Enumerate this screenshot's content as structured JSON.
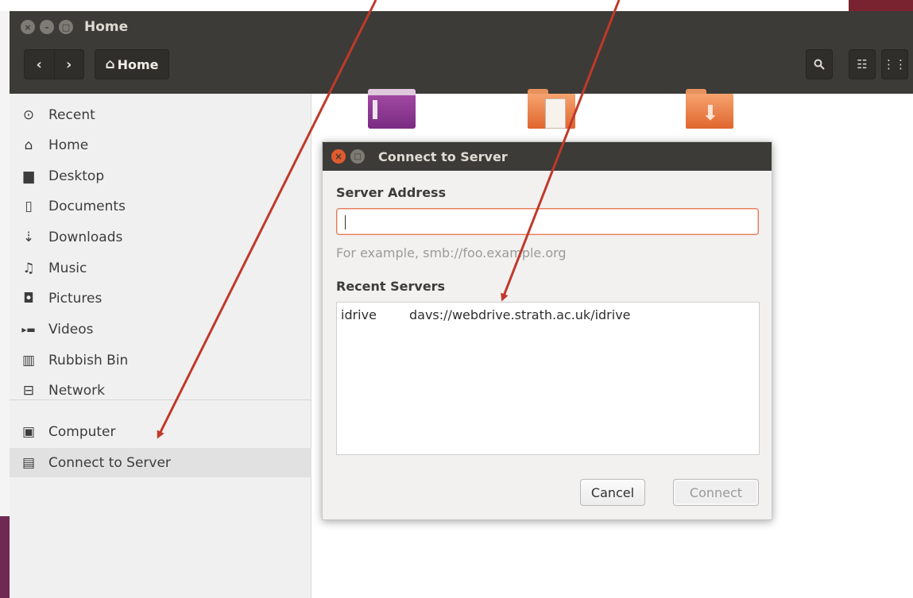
{
  "window": {
    "title": "Home",
    "path_label": "Home"
  },
  "sidebar": {
    "items": [
      {
        "label": "Recent",
        "icon": "recent-icon",
        "glyph": "⊙"
      },
      {
        "label": "Home",
        "icon": "home-icon",
        "glyph": "⌂"
      },
      {
        "label": "Desktop",
        "icon": "folder-icon",
        "glyph": "▆"
      },
      {
        "label": "Documents",
        "icon": "document-icon",
        "glyph": "▯"
      },
      {
        "label": "Downloads",
        "icon": "download-icon",
        "glyph": "⇣"
      },
      {
        "label": "Music",
        "icon": "music-icon",
        "glyph": "♫"
      },
      {
        "label": "Pictures",
        "icon": "camera-icon",
        "glyph": "◘"
      },
      {
        "label": "Videos",
        "icon": "video-icon",
        "glyph": "▸▬"
      },
      {
        "label": "Rubbish Bin",
        "icon": "trash-icon",
        "glyph": "▥"
      },
      {
        "label": "Network",
        "icon": "network-icon",
        "glyph": "⊟"
      }
    ],
    "devices": [
      {
        "label": "Computer",
        "icon": "computer-icon",
        "glyph": "▣"
      },
      {
        "label": "Connect to Server",
        "icon": "server-icon",
        "glyph": "▤"
      }
    ]
  },
  "dialog": {
    "title": "Connect to Server",
    "server_address_label": "Server Address",
    "server_address_value": "",
    "hint": "For example, smb://foo.example.org",
    "recent_label": "Recent Servers",
    "recent_servers": [
      {
        "name": "idrive",
        "url": "davs://webdrive.strath.ac.uk/idrive"
      }
    ],
    "cancel_label": "Cancel",
    "connect_label": "Connect"
  },
  "colors": {
    "titlebar": "#3c3b37",
    "accent_orange": "#e25b2f",
    "annotation_arrow": "#c0392b"
  }
}
